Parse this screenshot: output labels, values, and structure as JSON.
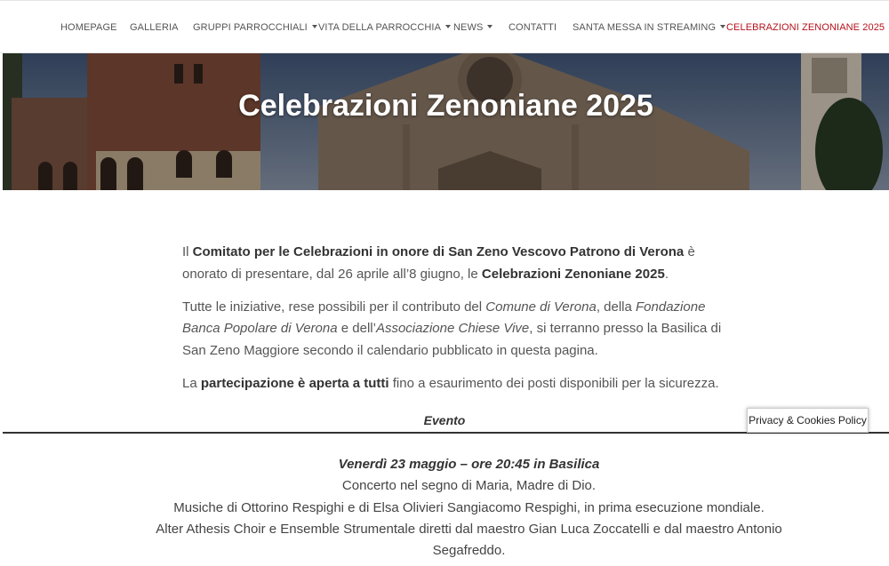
{
  "nav": {
    "items": [
      {
        "label": "HOMEPAGE",
        "dropdown": false
      },
      {
        "label": "GALLERIA",
        "dropdown": false
      },
      {
        "label": "GRUPPI PARROCCHIALI",
        "dropdown": true
      },
      {
        "label": "VITA DELLA PARROCCHIA",
        "dropdown": true
      },
      {
        "label": "NEWS",
        "dropdown": true
      },
      {
        "label": "CONTATTI",
        "dropdown": false
      },
      {
        "label": "SANTA MESSA IN STREAMING",
        "dropdown": true
      },
      {
        "label": "CELEBRAZIONI ZENONIANE 2025",
        "dropdown": false,
        "active": true
      }
    ],
    "active_color": "#b5121b"
  },
  "hero": {
    "title": "Celebrazioni Zenoniane 2025"
  },
  "intro": {
    "p1": {
      "a": "Il ",
      "b": "Comitato per le Celebrazioni in onore di San Zeno Vescovo Patrono di Verona",
      "c": " è onorato di presentare, dal 26 aprile all’8 giugno, le ",
      "d": "Celebrazioni Zenoniane 2025",
      "e": "."
    },
    "p2": {
      "a": "Tutte le iniziative, rese possibili per il contributo del ",
      "b": "Comune di Verona",
      "c": ", della ",
      "d": "Fondazione Banca Popolare di Verona",
      "e": " e dell’",
      "f": "Associazione Chiese Vive",
      "g": ", si terranno presso la Basilica di San Zeno Maggiore secondo il calendario pubblicato in questa pagina."
    },
    "p3": {
      "a": "La ",
      "b": "partecipazione è aperta a tutti",
      "c": " fino a esaurimento dei posti disponibili per la sicurezza."
    }
  },
  "table": {
    "header": "Evento"
  },
  "event": {
    "date": "Venerdì 23 maggio – ore 20:45 in Basilica",
    "line1": "Concerto nel segno di Maria, Madre di Dio.",
    "line2": "Musiche di Ottorino Respighi e di Elsa Olivieri Sangiacomo Respighi, in prima esecuzione mondiale.",
    "line3": "Alter Athesis Choir e Ensemble Strumentale diretti dal maestro Gian Luca Zoccatelli e dal maestro Antonio",
    "line4": "Segafreddo."
  },
  "privacy": {
    "label": "Privacy & Cookies Policy"
  }
}
